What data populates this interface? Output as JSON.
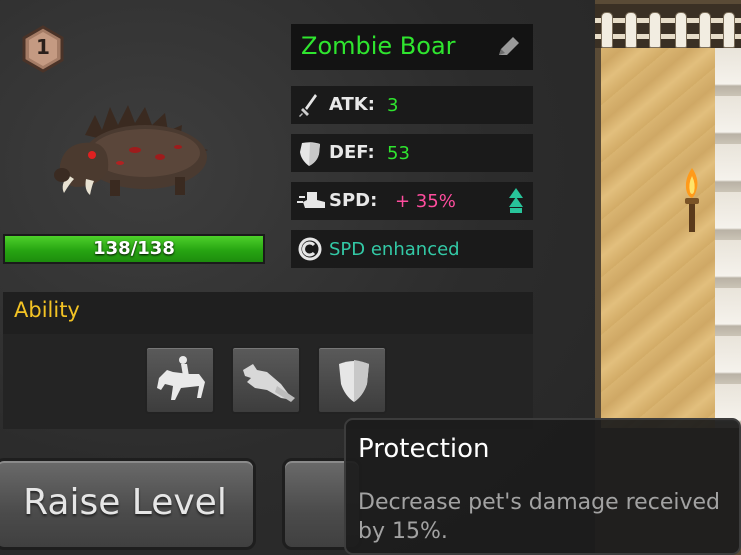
{
  "pet": {
    "level": "1",
    "name": "Zombie Boar",
    "hp_text": "138/138",
    "hp_fraction": 1.0
  },
  "stats": {
    "atk": {
      "label": "ATK:",
      "value": "3",
      "color": "#2fe52f"
    },
    "def": {
      "label": "DEF:",
      "value": "53",
      "color": "#2fe52f"
    },
    "spd": {
      "label": "SPD:",
      "value": "+ 35%",
      "color": "#ff4d9e"
    },
    "effect": {
      "text": "SPD enhanced",
      "color": "#33c9a6"
    }
  },
  "ability": {
    "header": "Ability",
    "items": [
      {
        "icon": "horse-rider-icon"
      },
      {
        "icon": "charging-wolf-icon"
      },
      {
        "icon": "shield-icon"
      }
    ]
  },
  "buttons": {
    "raise_level": "Raise Level",
    "second": ""
  },
  "tooltip": {
    "title": "Protection",
    "description": "Decrease pet's damage received by 15%."
  },
  "colors": {
    "name_green": "#2fe52f",
    "ability_gold": "#f3c324",
    "hp_green": "#27a512"
  }
}
